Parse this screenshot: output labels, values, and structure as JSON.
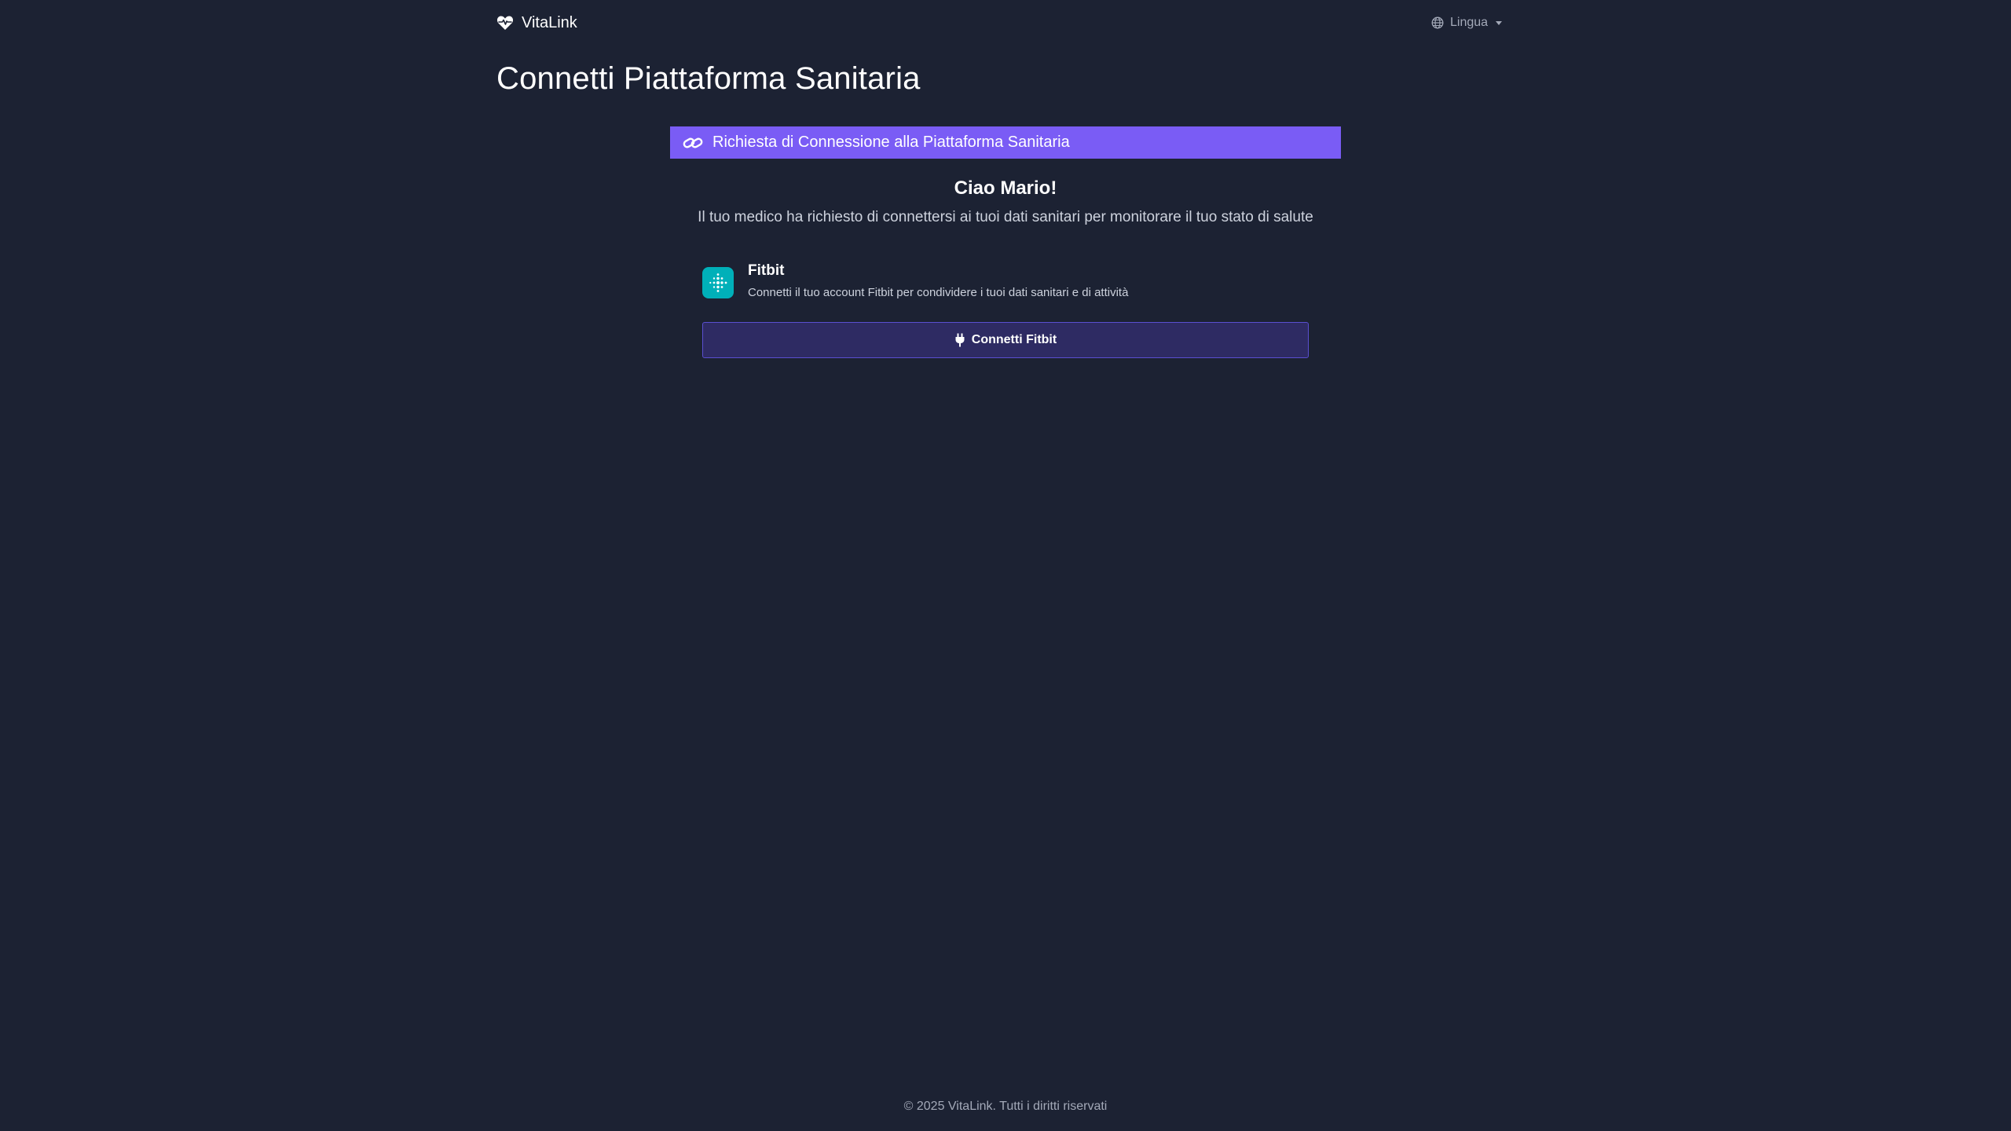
{
  "navbar": {
    "brand": "VitaLink",
    "brand_icon": "heart-pulse-icon",
    "language_label": "Lingua",
    "language_icon": "globe-icon"
  },
  "page": {
    "title": "Connetti Piattaforma Sanitaria"
  },
  "card": {
    "header": "Richiesta di Connessione alla Piattaforma Sanitaria",
    "header_icon": "link-icon",
    "header_color": "#7a5cf5",
    "greeting": "Ciao Mario!",
    "description": "Il tuo medico ha richiesto di connettersi ai tuoi dati sanitari per monitorare il tuo stato di salute"
  },
  "platform": {
    "name": "Fitbit",
    "description": "Connetti il tuo account Fitbit per condividere i tuoi dati sanitari e di attività",
    "logo_icon": "fitbit-logo-icon",
    "logo_color": "#00b0b9"
  },
  "connect_button": {
    "label": "Connetti Fitbit",
    "icon": "plug-icon"
  },
  "footer": {
    "text": "© 2025 VitaLink. Tutti i diritti riservati"
  },
  "colors": {
    "background": "#1c2233",
    "button_bg": "#2e2b63",
    "button_border": "#5a4fd0"
  }
}
